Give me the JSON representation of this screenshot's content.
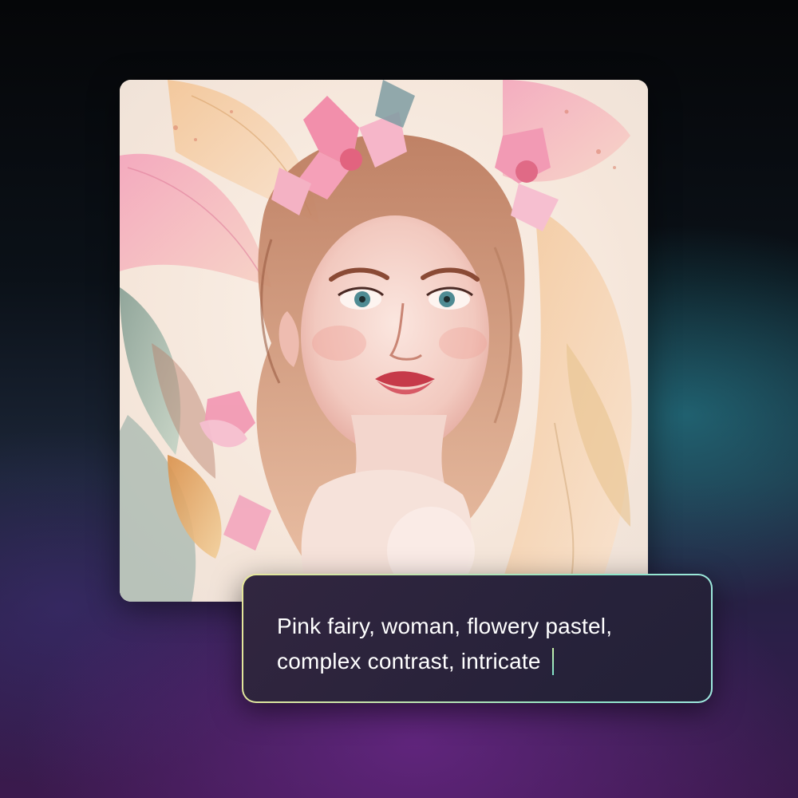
{
  "image": {
    "alt": "Watercolor painting of a pink fairy woman with flowers in her hair"
  },
  "prompt": {
    "line1": "Pink fairy, woman, flowery pastel,",
    "line2": "complex contrast, intricate"
  },
  "colors": {
    "background_top": "#050608",
    "background_teal_glow": "#2896a5",
    "background_purple_glow": "#6e288c",
    "prompt_box_bg": "#2a1e3c",
    "prompt_border_start": "#e6e79a",
    "prompt_border_end": "#9fe8e0",
    "caret": "#7fe0c8",
    "text": "#ffffff"
  }
}
